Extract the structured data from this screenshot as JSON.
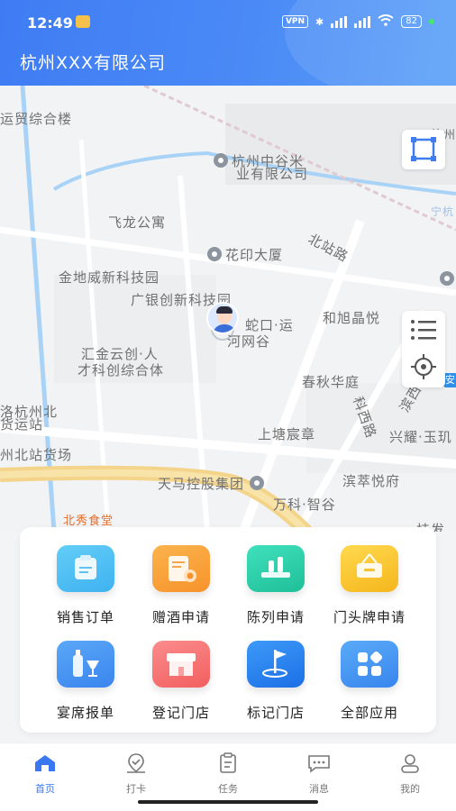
{
  "statusbar": {
    "time": "12:49",
    "vpn": "VPN",
    "battery": "82"
  },
  "header": {
    "company": "杭州XXX有限公司"
  },
  "map": {
    "labels": [
      "运贸综合楼",
      "杭州中谷米",
      "业有限公司",
      "飞龙公寓",
      "花印大厦",
      "北站路",
      "金地威新科技园",
      "广银创新科技园",
      "蛇口·运",
      "河网谷",
      "和旭晶悦",
      "汇金云创·人",
      "才科创综合体",
      "春秋华庭",
      "滨西街",
      "科西路",
      "洛杭州北",
      "货运站",
      "州北站货场",
      "上塘宸章",
      "兴耀·玉玑",
      "天马控股集团",
      "滨萃悦府",
      "万科·智谷",
      "北秀食堂",
      "宁杭",
      "杭州",
      "安",
      "桂发"
    ]
  },
  "apps": [
    {
      "label": "销售订单",
      "icon": "sales-order-icon",
      "color": "#3fb2f0"
    },
    {
      "label": "赠酒申请",
      "icon": "gift-wine-icon",
      "color": "#f7932b"
    },
    {
      "label": "陈列申请",
      "icon": "display-icon",
      "color": "#22c9a4"
    },
    {
      "label": "门头牌申请",
      "icon": "signboard-icon",
      "color": "#f8c12c"
    },
    {
      "label": "宴席报单",
      "icon": "banquet-icon",
      "color": "#3f8ff0"
    },
    {
      "label": "登记门店",
      "icon": "register-store-icon",
      "color": "#f66e6e"
    },
    {
      "label": "标记门店",
      "icon": "mark-store-icon",
      "color": "#2a7ef0"
    },
    {
      "label": "全部应用",
      "icon": "all-apps-icon",
      "color": "#3b8ff2"
    }
  ],
  "tabs": [
    {
      "label": "首页",
      "icon": "home-icon"
    },
    {
      "label": "打卡",
      "icon": "checkin-icon"
    },
    {
      "label": "任务",
      "icon": "task-icon"
    },
    {
      "label": "消息",
      "icon": "message-icon"
    },
    {
      "label": "我的",
      "icon": "profile-icon"
    }
  ]
}
